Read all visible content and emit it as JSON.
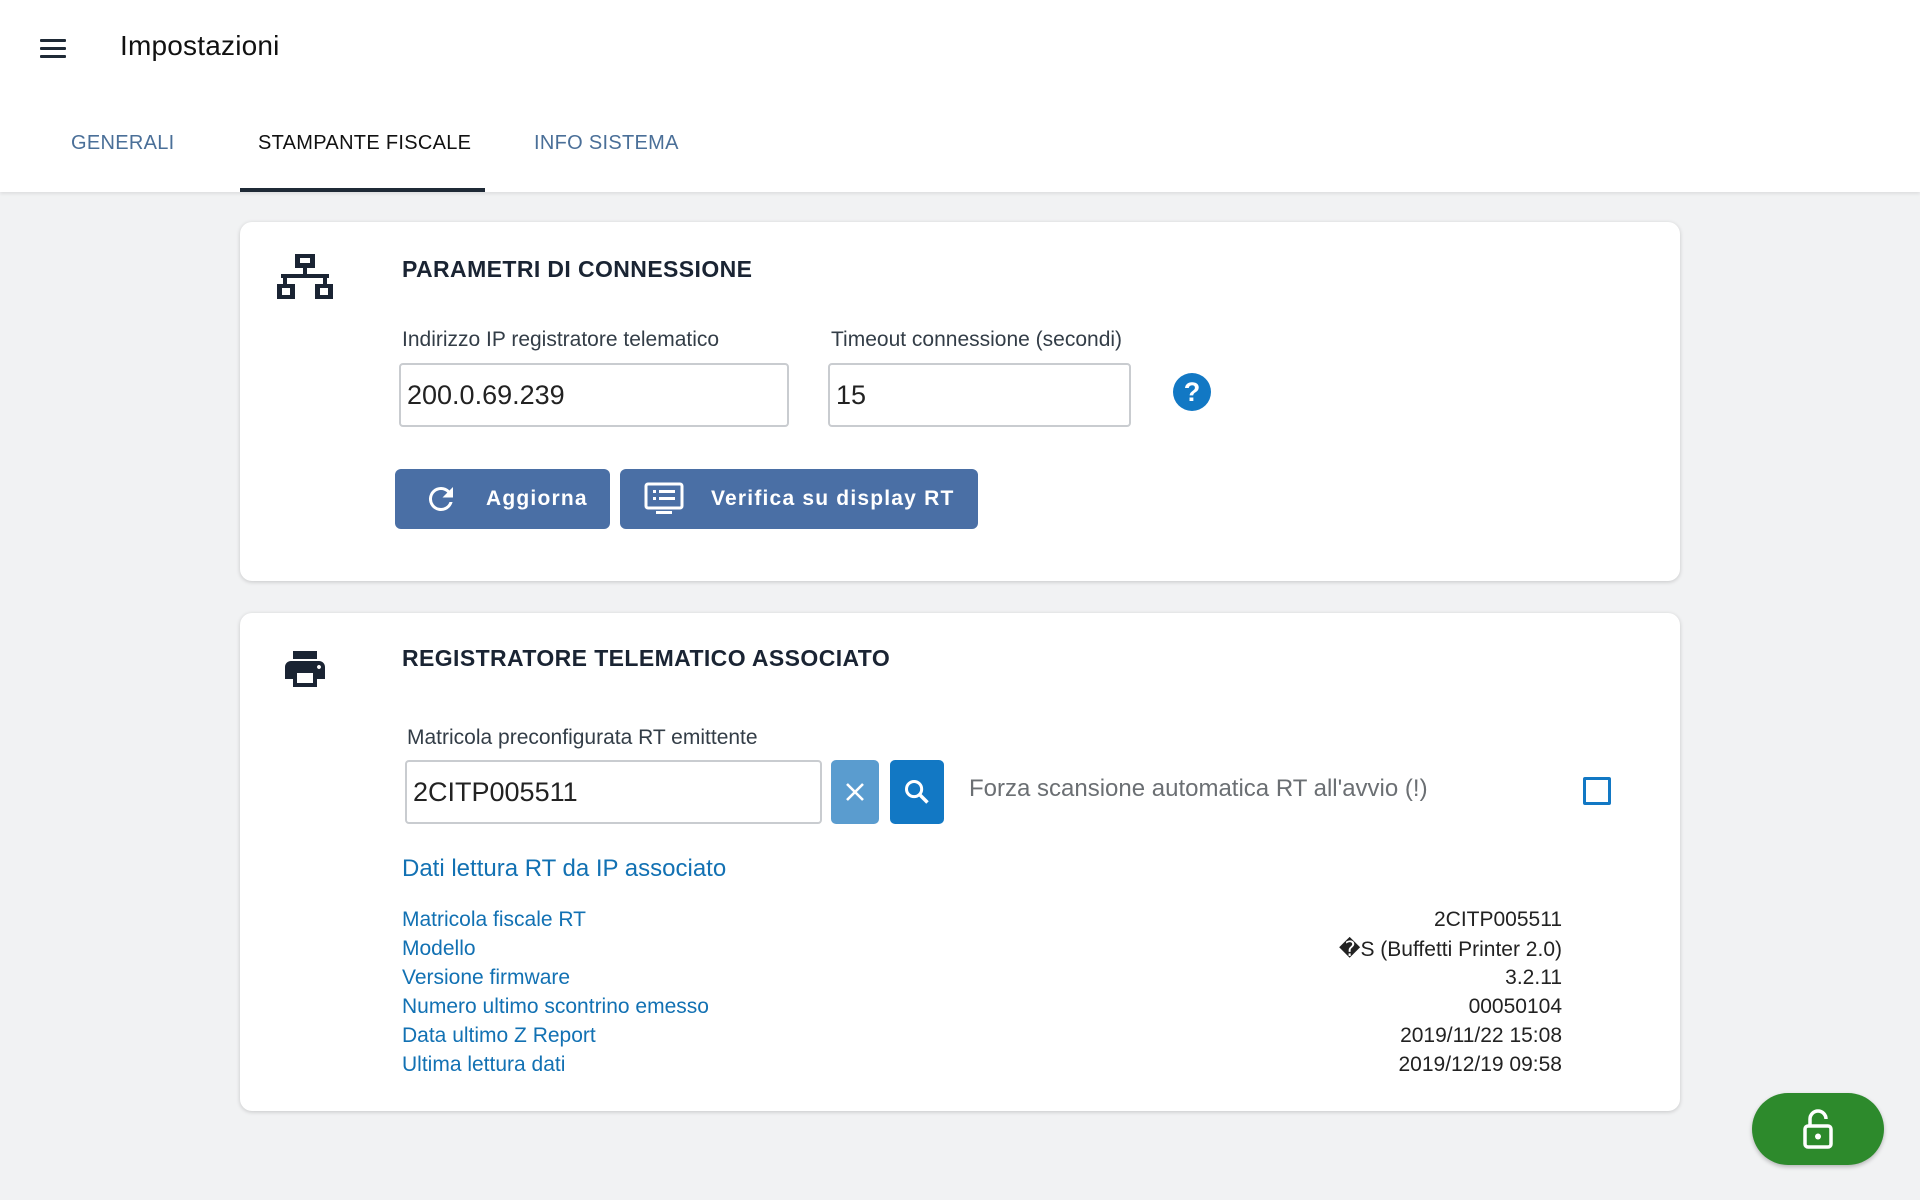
{
  "app": {
    "title": "Impostazioni",
    "menu_icon": "hamburger-menu-icon"
  },
  "tabs": [
    {
      "label": "GENERALI",
      "active": false
    },
    {
      "label": "STAMPANTE FISCALE",
      "active": true
    },
    {
      "label": "INFO SISTEMA",
      "active": false
    }
  ],
  "connection": {
    "title": "PARAMETRI DI CONNESSIONE",
    "icon": "network-icon",
    "ip_label": "Indirizzo IP registratore telematico",
    "ip_value": "200.0.69.239",
    "timeout_label": "Timeout connessione (secondi)",
    "timeout_value": "15",
    "help_icon": "help-icon",
    "help_glyph": "?",
    "refresh_label": "Aggiorna",
    "verify_label": "Verifica su display RT"
  },
  "rt": {
    "title": "REGISTRATORE TELEMATICO ASSOCIATO",
    "icon": "printer-icon",
    "serial_label": "Matricola preconfigurata RT emittente",
    "serial_value": "2CITP005511",
    "force_scan_label": "Forza scansione automatica RT all'avvio (!)",
    "force_scan_checked": false,
    "data_heading": "Dati lettura RT da IP associato",
    "rows": [
      {
        "label": "Matricola fiscale RT",
        "value": "2CITP005511"
      },
      {
        "label": "Modello",
        "value": "�S (Buffetti Printer 2.0)"
      },
      {
        "label": "Versione firmware",
        "value": "3.2.11"
      },
      {
        "label": "Numero ultimo scontrino emesso",
        "value": "00050104"
      },
      {
        "label": "Data ultimo Z Report",
        "value": "2019/11/22 15:08"
      },
      {
        "label": "Ultima lettura dati",
        "value": "2019/12/19 09:58"
      }
    ]
  },
  "colors": {
    "accent": "#4a6fa5",
    "link": "#1271b3",
    "primary_blue": "#1278c4",
    "clear_button": "#5a9ccf",
    "fab_green": "#2d8a2c"
  },
  "fab": {
    "icon": "lock-open-icon"
  }
}
